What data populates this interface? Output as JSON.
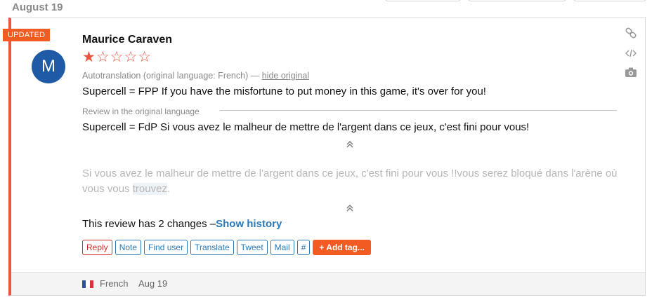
{
  "date_header": "August 19",
  "badge": "UPDATED",
  "review": {
    "avatar_letter": "M",
    "author": "Maurice Caraven",
    "stars_filled": "★",
    "stars_empty": "☆☆☆☆",
    "rating": 1,
    "rating_max": 5,
    "autotranslation_text": "Autotranslation (original language: French) —",
    "hide_original": "hide original",
    "translated_text": "Supercell = FPP If you have the misfortune to put money in this game, it's over for you!",
    "original_label": "Review in the original language",
    "original_text": "Supercell = FdP Si vous avez le malheur de mettre de l'argent dans ce jeux, c'est fini pour vous!",
    "faded_text_part1": "Si vous avez le malheur de mettre de l'argent dans ce jeux, c'est fini pour vous !!vous serez bloqué dans l'arène où vous vous ",
    "faded_text_highlight": "trouvez",
    "faded_text_end": ".",
    "changes_text": "This review has 2 changes –",
    "show_history": "Show history"
  },
  "actions": {
    "reply": "Reply",
    "note": "Note",
    "find_user": "Find user",
    "translate": "Translate",
    "tweet": "Tweet",
    "mail": "Mail",
    "hash": "#",
    "add_tag": "+ Add tag..."
  },
  "footer": {
    "language": "French",
    "date": "Aug 19"
  },
  "colors": {
    "accent": "#e8563f",
    "badge": "#f25b22",
    "link": "#2a7ab8",
    "avatar": "#1f5aa6"
  },
  "icons": {
    "link": "link-icon",
    "embed": "code-icon",
    "screenshot": "camera-icon",
    "collapse": "chevron-double-up-icon",
    "flag": "flag-france-icon"
  }
}
